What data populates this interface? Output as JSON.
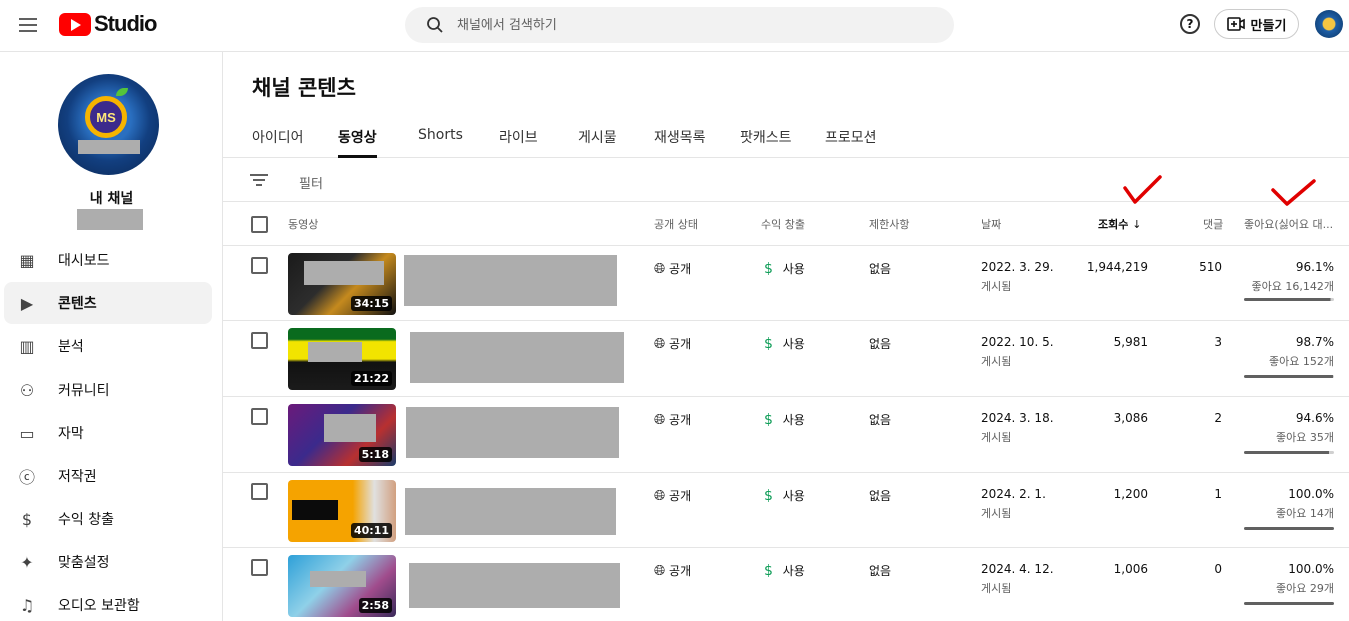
{
  "header": {
    "logo_text": "Studio",
    "search_placeholder": "채널에서 검색하기",
    "create_label": "만들기",
    "help_glyph": "?"
  },
  "sidebar": {
    "channel_label": "내 채널",
    "avatar_text": "MS",
    "items": [
      {
        "label": "대시보드",
        "icon": "dashboard-icon",
        "glyph": "▦"
      },
      {
        "label": "콘텐츠",
        "icon": "content-icon",
        "glyph": "▶"
      },
      {
        "label": "분석",
        "icon": "analytics-icon",
        "glyph": "▥"
      },
      {
        "label": "커뮤니티",
        "icon": "community-icon",
        "glyph": "⚇"
      },
      {
        "label": "자막",
        "icon": "subtitles-icon",
        "glyph": "▭"
      },
      {
        "label": "저작권",
        "icon": "copyright-icon",
        "glyph": "ⓒ"
      },
      {
        "label": "수익 창출",
        "icon": "monetization-icon",
        "glyph": "$"
      },
      {
        "label": "맞춤설정",
        "icon": "customization-icon",
        "glyph": "✦"
      },
      {
        "label": "오디오 보관함",
        "icon": "audio-library-icon",
        "glyph": "♫"
      }
    ]
  },
  "main": {
    "title": "채널 콘텐츠",
    "tabs": [
      {
        "label": "아이디어"
      },
      {
        "label": "동영상"
      },
      {
        "label": "Shorts"
      },
      {
        "label": "라이브"
      },
      {
        "label": "게시물"
      },
      {
        "label": "재생목록"
      },
      {
        "label": "팟캐스트"
      },
      {
        "label": "프로모션"
      }
    ],
    "active_tab": "동영상",
    "filter_label": "필터",
    "columns": {
      "video": "동영상",
      "visibility": "공개 상태",
      "monetization": "수익 창출",
      "restrictions": "제한사항",
      "date": "날짜",
      "views": "조회수",
      "views_sort_glyph": "↓",
      "comments": "댓글",
      "likes": "좋아요(싫어요 대..."
    },
    "rows": [
      {
        "duration": "34:15",
        "visibility": "공개",
        "monetization": "사용",
        "restrictions": "없음",
        "date": "2022. 3. 29.",
        "date_sub": "게시됨",
        "views": "1,944,219",
        "comments": "510",
        "like_pct": "96.1%",
        "like_count": "좋아요 16,142개",
        "like_ratio": 0.961
      },
      {
        "duration": "21:22",
        "visibility": "공개",
        "monetization": "사용",
        "restrictions": "없음",
        "date": "2022. 10. 5.",
        "date_sub": "게시됨",
        "views": "5,981",
        "comments": "3",
        "like_pct": "98.7%",
        "like_count": "좋아요 152개",
        "like_ratio": 0.987
      },
      {
        "duration": "5:18",
        "visibility": "공개",
        "monetization": "사용",
        "restrictions": "없음",
        "date": "2024. 3. 18.",
        "date_sub": "게시됨",
        "views": "3,086",
        "comments": "2",
        "like_pct": "94.6%",
        "like_count": "좋아요 35개",
        "like_ratio": 0.946
      },
      {
        "duration": "40:11",
        "visibility": "공개",
        "monetization": "사용",
        "restrictions": "없음",
        "date": "2024. 2. 1.",
        "date_sub": "게시됨",
        "views": "1,200",
        "comments": "1",
        "like_pct": "100.0%",
        "like_count": "좋아요 14개",
        "like_ratio": 1.0
      },
      {
        "duration": "2:58",
        "visibility": "공개",
        "monetization": "사용",
        "restrictions": "없음",
        "date": "2024. 4. 12.",
        "date_sub": "게시됨",
        "views": "1,006",
        "comments": "0",
        "like_pct": "100.0%",
        "like_count": "좋아요 29개",
        "like_ratio": 1.0
      }
    ]
  },
  "colors": {
    "brand": "#ff0000",
    "annotation": "#e00000",
    "monetization": "#0f9d58"
  }
}
